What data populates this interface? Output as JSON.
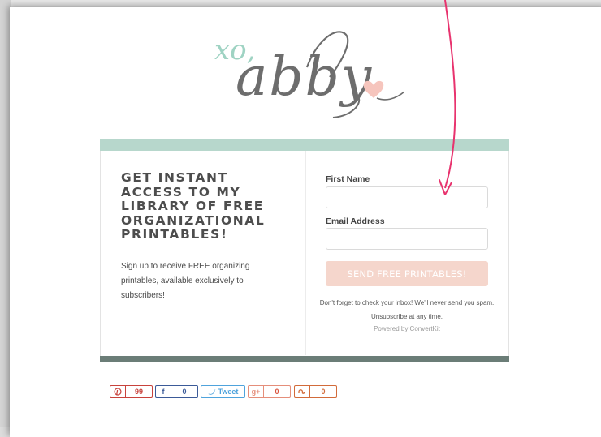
{
  "logo": {
    "prefix": "xo,",
    "name": "abby"
  },
  "form": {
    "headline": "GET INSTANT ACCESS TO MY LIBRARY OF FREE ORGANIZATIONAL PRINTABLES!",
    "subtext": "Sign up to receive FREE organizing printables, available exclusively to subscribers!",
    "first_name_label": "First Name",
    "first_name_value": "",
    "email_label": "Email Address",
    "email_value": "",
    "submit_label": "SEND FREE PRINTABLES!",
    "note": "Don't forget to check your inbox! We'll never send you spam. Unsubscribe at any time.",
    "powered_by": "Powered by ConvertKit"
  },
  "share": {
    "pinterest": {
      "icon": "pinterest-icon",
      "count": "99"
    },
    "facebook": {
      "icon": "facebook-icon",
      "count": "0"
    },
    "twitter": {
      "icon": "twitter-icon",
      "label": "Tweet"
    },
    "googleplus": {
      "icon": "google-plus-icon",
      "count": "0"
    },
    "stumbleupon": {
      "icon": "stumbleupon-icon",
      "count": "0"
    }
  },
  "colors": {
    "band_top": "#b7d7cc",
    "band_bottom": "#6b7d77",
    "button": "#f5d6cc",
    "arrow": "#e8336e",
    "logo_grey": "#6d6d6d",
    "logo_mint": "#9fd3c3",
    "heart": "#f6c5bd"
  }
}
